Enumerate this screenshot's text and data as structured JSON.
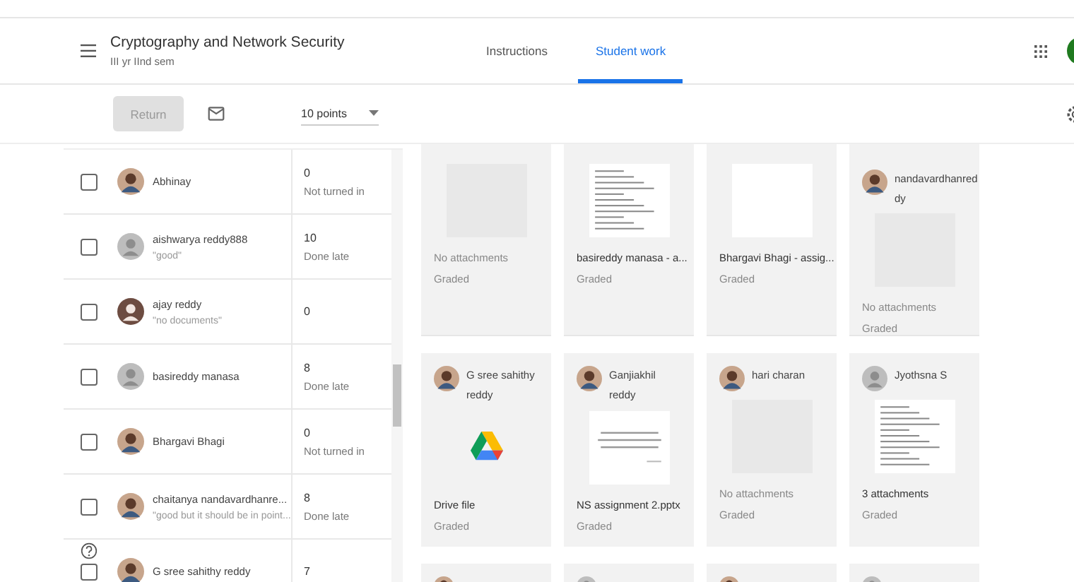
{
  "course": {
    "title": "Cryptography and Network Security",
    "subtitle": "III yr IInd sem"
  },
  "tabs": [
    {
      "label": "Instructions",
      "selected": false
    },
    {
      "label": "Student work",
      "selected": true
    }
  ],
  "toolbar": {
    "return_label": "Return",
    "return_disabled": true,
    "points": "10 points"
  },
  "students": [
    {
      "name": "Abhinay",
      "avatar": {
        "kind": "photo"
      },
      "grade": "0",
      "status": "Not turned in",
      "checked": false
    },
    {
      "name": "aishwarya reddy888",
      "comment": "\"good\"",
      "avatar": {
        "kind": "default"
      },
      "grade": "10",
      "status": "Done late",
      "checked": false
    },
    {
      "name": "ajay reddy",
      "comment": "\"no documents\"",
      "avatar": {
        "kind": "brown"
      },
      "grade": "0",
      "checked": false
    },
    {
      "name": "basireddy manasa",
      "avatar": {
        "kind": "default"
      },
      "grade": "8",
      "status": "Done late",
      "checked": false
    },
    {
      "name": "Bhargavi Bhagi",
      "avatar": {
        "kind": "photo"
      },
      "grade": "0",
      "status": "Not turned in",
      "checked": false
    },
    {
      "name": "chaitanya nandavardhanre...",
      "comment": "\"good but it should be in point...",
      "avatar": {
        "kind": "photo"
      },
      "grade": "8",
      "status": "Done late",
      "checked": false
    },
    {
      "name": "G sree sahithy reddy",
      "avatar": {
        "kind": "photo"
      },
      "grade": "7",
      "checked": false
    }
  ],
  "cards": [
    {
      "preview": {
        "kind": "blank"
      },
      "caption": "No attachments",
      "muted": true,
      "state": "Graded"
    },
    {
      "preview": {
        "kind": "doc"
      },
      "caption": "basireddy manasa - a...",
      "muted": false,
      "state": "Graded"
    },
    {
      "preview": {
        "kind": "white"
      },
      "caption": "Bhargavi Bhagi - assig...",
      "muted": false,
      "state": "Graded"
    },
    {
      "name": "nandavardhanreddy",
      "avatar": {
        "kind": "photo"
      },
      "preview": {
        "kind": "blank"
      },
      "caption": "No attachments",
      "muted": true,
      "state": "Graded"
    },
    {
      "name": "G sree sahithy reddy",
      "avatar": {
        "kind": "photo"
      },
      "preview": {
        "kind": "drive"
      },
      "caption": "Drive file",
      "muted": false,
      "state": "Graded"
    },
    {
      "name": "Ganjiakhil reddy",
      "avatar": {
        "kind": "photo"
      },
      "preview": {
        "kind": "slide"
      },
      "caption": "NS assignment 2.pptx",
      "muted": false,
      "state": "Graded"
    },
    {
      "name": "hari charan",
      "avatar": {
        "kind": "photo"
      },
      "preview": {
        "kind": "blank"
      },
      "caption": "No attachments",
      "muted": true,
      "state": "Graded"
    },
    {
      "name": "Jyothsna S",
      "avatar": {
        "kind": "default"
      },
      "preview": {
        "kind": "doc"
      },
      "caption": "3 attachments",
      "muted": false,
      "state": "Graded"
    }
  ],
  "next_cards": [
    {
      "avatar": {
        "kind": "photo"
      }
    },
    {
      "avatar": {
        "kind": "default"
      }
    },
    {
      "avatar": {
        "kind": "photo"
      }
    },
    {
      "avatar": {
        "kind": "default"
      }
    }
  ]
}
